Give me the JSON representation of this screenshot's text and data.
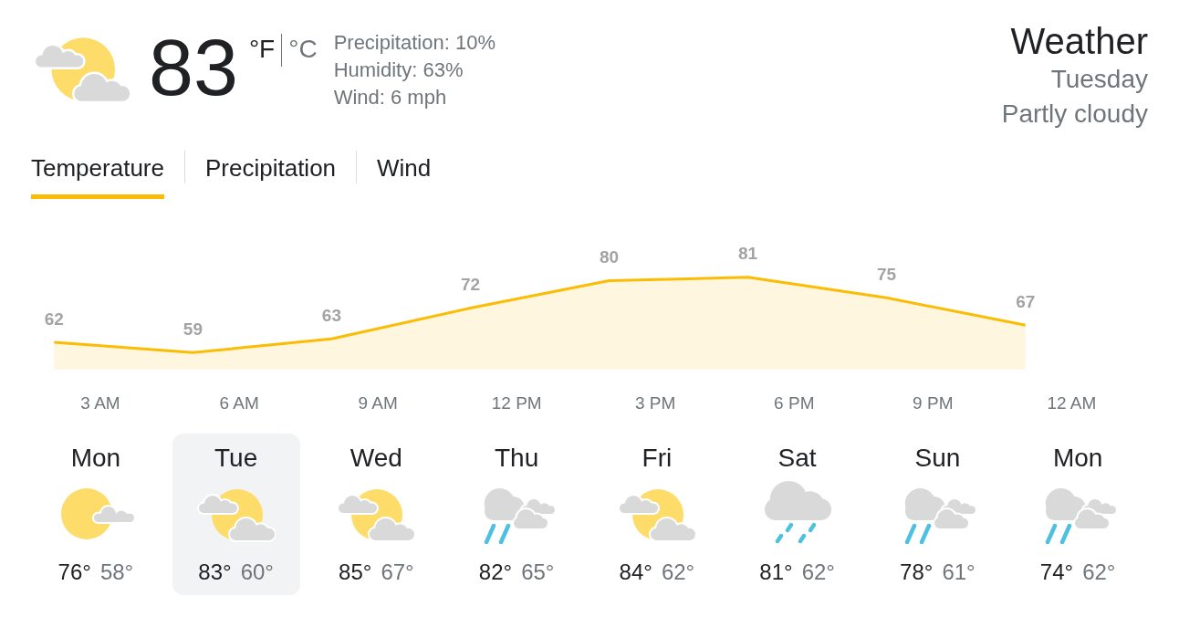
{
  "current": {
    "kind": "partly_cloudy",
    "temperature": "83",
    "units": [
      {
        "label": "°F",
        "selected": true
      },
      {
        "label": "°C",
        "selected": false
      }
    ],
    "details": [
      "Precipitation: 10%",
      "Humidity: 63%",
      "Wind: 6 mph"
    ]
  },
  "summary": {
    "title": "Weather",
    "day": "Tuesday",
    "condition": "Partly cloudy"
  },
  "tabs": [
    {
      "label": "Temperature",
      "selected": true
    },
    {
      "label": "Precipitation",
      "selected": false
    },
    {
      "label": "Wind",
      "selected": false
    }
  ],
  "hourly": {
    "chart_data": {
      "type": "area",
      "categories": [
        null,
        "3 AM",
        null,
        null,
        "6 AM",
        null,
        null,
        "9 AM",
        null,
        null,
        "12 PM",
        null,
        null,
        "3 PM",
        null,
        null,
        "6 PM",
        null,
        null,
        "9 PM",
        null,
        null,
        "12 AM",
        null
      ],
      "series": [
        {
          "color": "#fbbc04",
          "values": [
            62,
            null,
            null,
            59,
            null,
            null,
            63,
            null,
            null,
            72,
            null,
            null,
            80,
            null,
            null,
            81,
            null,
            null,
            75,
            null,
            null,
            67,
            null,
            null
          ]
        }
      ],
      "data_labels": true
    }
  },
  "days": [
    {
      "name": "Mon",
      "kind": "mostly_sunny",
      "high": "76°",
      "low": "58°",
      "selected": false
    },
    {
      "name": "Tue",
      "kind": "partly_cloudy",
      "high": "83°",
      "low": "60°",
      "selected": true
    },
    {
      "name": "Wed",
      "kind": "partly_cloudy",
      "high": "85°",
      "low": "67°",
      "selected": false
    },
    {
      "name": "Thu",
      "kind": "showers",
      "high": "82°",
      "low": "65°",
      "selected": false
    },
    {
      "name": "Fri",
      "kind": "partly_cloudy",
      "high": "84°",
      "low": "62°",
      "selected": false
    },
    {
      "name": "Sat",
      "kind": "light_rain",
      "high": "81°",
      "low": "62°",
      "selected": false
    },
    {
      "name": "Sun",
      "kind": "showers",
      "high": "78°",
      "low": "61°",
      "selected": false
    },
    {
      "name": "Mon",
      "kind": "showers",
      "high": "74°",
      "low": "62°",
      "selected": false
    }
  ]
}
